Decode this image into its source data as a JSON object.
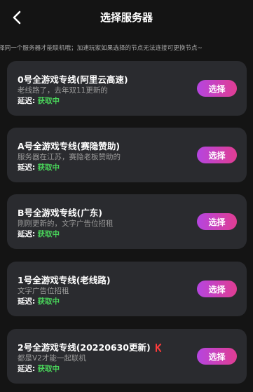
{
  "header": {
    "back_icon": "chevron-left-icon",
    "title": "选择服务器"
  },
  "notice": "择同一个服务器才能联机哦；加速玩家如果选择的节点无法连接可更换节点~",
  "servers": [
    {
      "name": "0号全游戏专线(阿里云高速)",
      "desc": "老线路了，去年双11更新的",
      "delay_label": "延迟:",
      "delay_value": "获取中",
      "button": "选择"
    },
    {
      "name": "A号全游戏专线(赛隐赞助)",
      "desc": "服务器在江苏，赛隐老板赞助的",
      "delay_label": "延迟:",
      "delay_value": "获取中",
      "button": "选择"
    },
    {
      "name": "B号全游戏专线(广东)",
      "desc": "刚刚更新的，文字广告位招租",
      "delay_label": "延迟:",
      "delay_value": "获取中",
      "button": "选择"
    },
    {
      "name": "1号全游戏专线(老线路)",
      "desc": "文字广告位招租",
      "delay_label": "延迟:",
      "delay_value": "获取中",
      "button": "选择"
    },
    {
      "name": "2号全游戏专线(20220630更新)",
      "desc": "都是V2才能一起联机",
      "delay_label": "延迟:",
      "delay_value": "获取中",
      "button": "选择",
      "badge_icon": "hot-icon"
    }
  ],
  "colors": {
    "background": "#141414",
    "card": "#2a2b2f",
    "delay_value": "#49d35a",
    "button_gradient_start": "#b545e0",
    "button_gradient_end": "#e03d92"
  }
}
